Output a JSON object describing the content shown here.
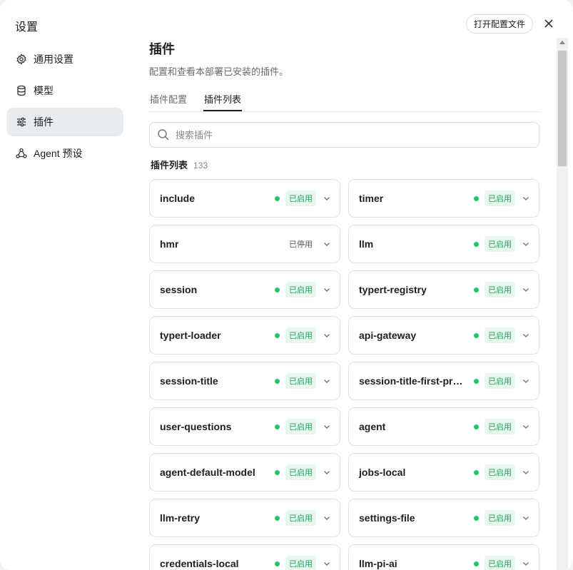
{
  "sidebar": {
    "title": "设置",
    "items": [
      {
        "label": "通用设置",
        "icon": "gear-icon"
      },
      {
        "label": "模型",
        "icon": "database-icon"
      },
      {
        "label": "插件",
        "icon": "sliders-icon",
        "active": true
      },
      {
        "label": "Agent 预设",
        "icon": "agent-icon"
      }
    ]
  },
  "header": {
    "open_config_label": "打开配置文件",
    "close_icon": "close-icon"
  },
  "main": {
    "title": "插件",
    "description": "配置和查看本部署已安装的插件。",
    "tabs": [
      {
        "label": "插件配置",
        "active": false
      },
      {
        "label": "插件列表",
        "active": true
      }
    ],
    "search": {
      "placeholder": "搜索插件",
      "value": ""
    },
    "list_title": "插件列表",
    "list_count": "133"
  },
  "plugins": [
    {
      "name": "include",
      "status": "已启用",
      "enabled": true
    },
    {
      "name": "timer",
      "status": "已启用",
      "enabled": true
    },
    {
      "name": "hmr",
      "status": "已停用",
      "enabled": false
    },
    {
      "name": "llm",
      "status": "已启用",
      "enabled": true
    },
    {
      "name": "session",
      "status": "已启用",
      "enabled": true
    },
    {
      "name": "typert-registry",
      "status": "已启用",
      "enabled": true
    },
    {
      "name": "typert-loader",
      "status": "已启用",
      "enabled": true
    },
    {
      "name": "api-gateway",
      "status": "已启用",
      "enabled": true
    },
    {
      "name": "session-title",
      "status": "已启用",
      "enabled": true
    },
    {
      "name": "session-title-first-pro...",
      "status": "已启用",
      "enabled": true
    },
    {
      "name": "user-questions",
      "status": "已启用",
      "enabled": true
    },
    {
      "name": "agent",
      "status": "已启用",
      "enabled": true
    },
    {
      "name": "agent-default-model",
      "status": "已启用",
      "enabled": true
    },
    {
      "name": "jobs-local",
      "status": "已启用",
      "enabled": true
    },
    {
      "name": "llm-retry",
      "status": "已启用",
      "enabled": true
    },
    {
      "name": "settings-file",
      "status": "已启用",
      "enabled": true
    },
    {
      "name": "credentials-local",
      "status": "已启用",
      "enabled": true
    },
    {
      "name": "llm-pi-ai",
      "status": "已启用",
      "enabled": true
    }
  ],
  "colors": {
    "enabled_dot": "#22c55e",
    "enabled_badge_bg": "#e7f8ee",
    "enabled_badge_text": "#22a35a",
    "active_nav_bg": "#e8ebf0"
  }
}
